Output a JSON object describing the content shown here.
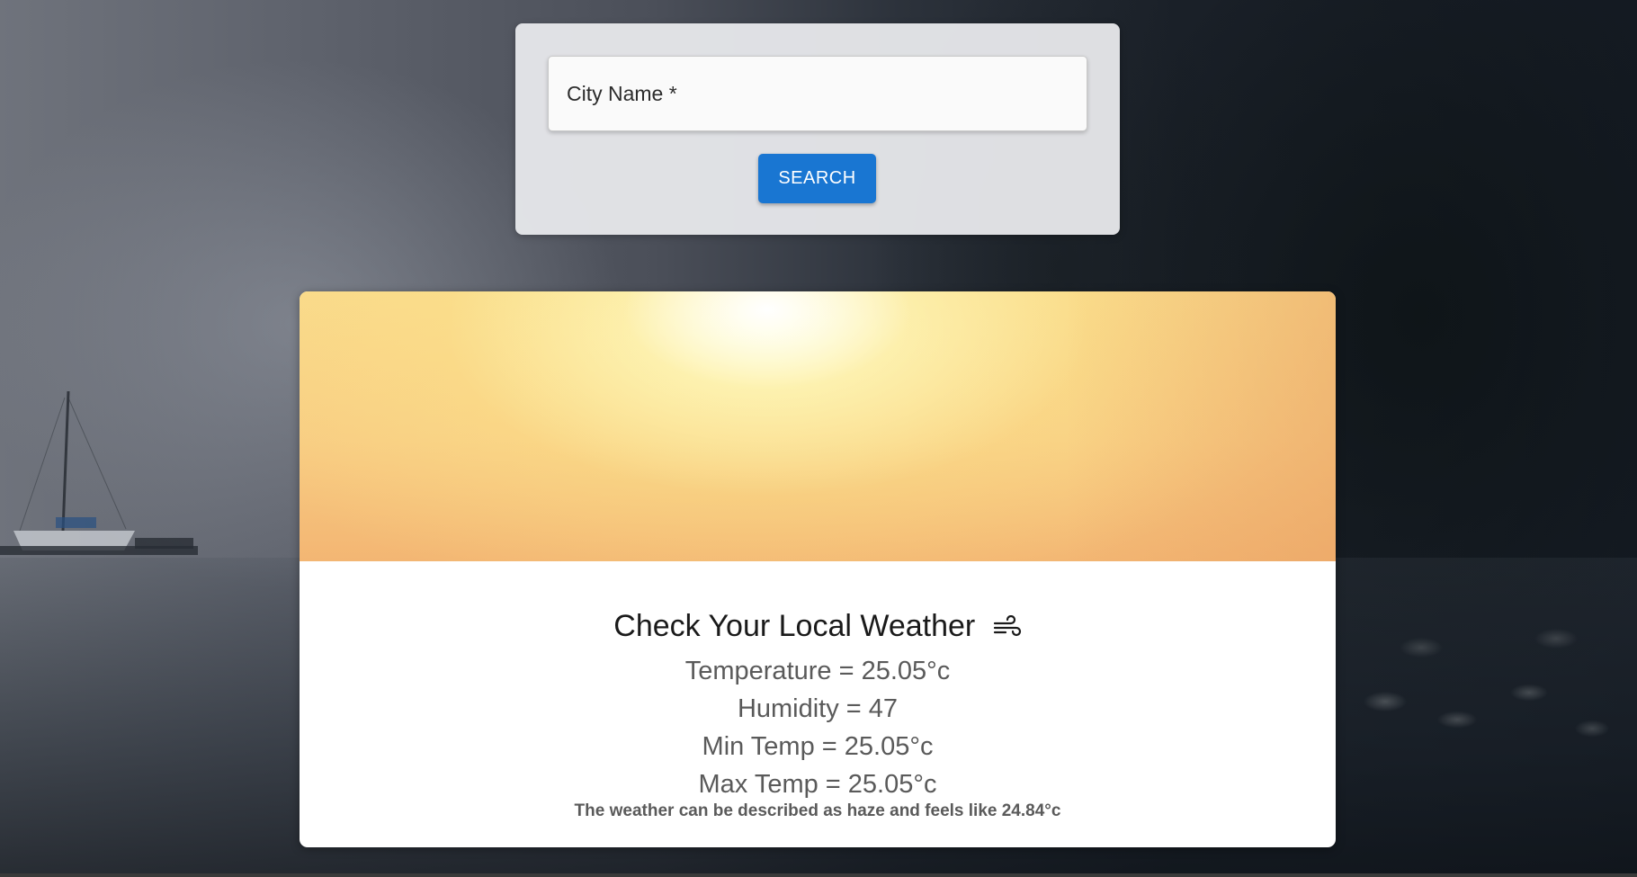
{
  "search": {
    "placeholder": "City Name *",
    "value": "",
    "button_label": "SEARCH"
  },
  "weather": {
    "title": "Check Your Local Weather",
    "title_icon": "wind-icon",
    "temperature": "Temperature = 25.05°c",
    "humidity": "Humidity = 47",
    "min_temp": "Min Temp = 25.05°c",
    "max_temp": "Max Temp = 25.05°c",
    "description": "The weather can be described as haze and feels like 24.84°c"
  },
  "colors": {
    "accent": "#1976d2",
    "card_background": "#ffffff",
    "search_card_background": "#e6e7ea",
    "title_text": "#1a1a1a",
    "body_text": "#5a5a5a"
  }
}
